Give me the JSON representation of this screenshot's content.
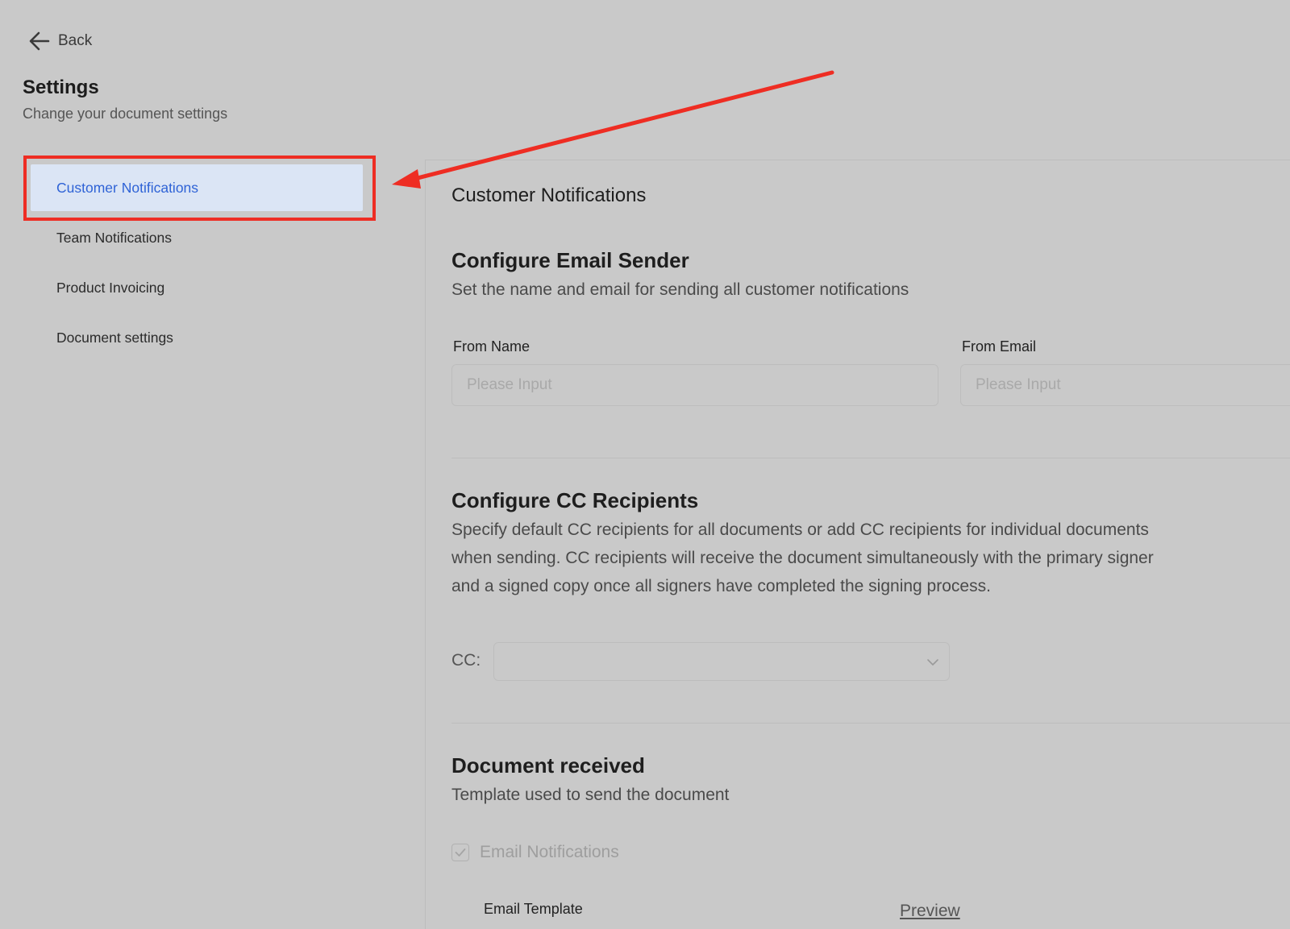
{
  "back": {
    "label": "Back",
    "icon": "arrow-left-icon"
  },
  "sidebar": {
    "title": "Settings",
    "subtitle": "Change your document settings",
    "items": [
      {
        "label": "Customer Notifications",
        "active": true
      },
      {
        "label": "Team Notifications",
        "active": false
      },
      {
        "label": "Product Invoicing",
        "active": false
      },
      {
        "label": "Document settings",
        "active": false
      }
    ]
  },
  "main": {
    "section_title": "Customer Notifications",
    "email_sender": {
      "heading": "Configure Email Sender",
      "description": "Set the name and email for sending all customer notifications",
      "from_name_label": "From Name",
      "from_name_placeholder": "Please Input",
      "from_name_value": "",
      "from_email_label": "From Email",
      "from_email_placeholder": "Please Input",
      "from_email_value": ""
    },
    "cc": {
      "heading": "Configure CC Recipients",
      "description_lines": [
        "Specify default CC recipients for all documents or add CC recipients for individual documents",
        "when sending. CC recipients will receive the document simultaneously with the primary signer",
        "and a signed copy once all signers have completed the signing process."
      ],
      "label": "CC:",
      "selected": ""
    },
    "document_received": {
      "heading": "Document received",
      "description": "Template used to send the document",
      "email_notifications_label": "Email Notifications",
      "email_notifications_checked": true,
      "email_template_label": "Email Template",
      "preview_label": "Preview"
    }
  },
  "annotation": {
    "highlight_color": "#ee2d23"
  },
  "colors": {
    "background": "#c9c9c9",
    "active_item_bg": "#dbe5f5",
    "active_item_text": "#2f63d6"
  }
}
